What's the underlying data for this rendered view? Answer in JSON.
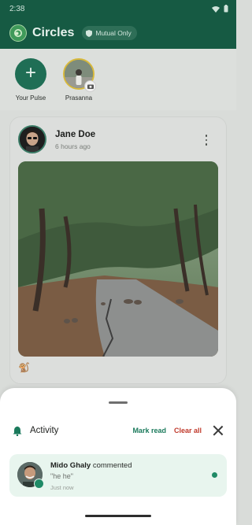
{
  "status": {
    "time": "2:38"
  },
  "header": {
    "app_title": "Circles",
    "audience_badge": "Mutual Only"
  },
  "stories": [
    {
      "label": "Your Pulse",
      "icon": "plus-icon"
    },
    {
      "label": "Prasanna",
      "icon": "avatar"
    }
  ],
  "post": {
    "author": "Jane Doe",
    "time": "6 hours ago",
    "reaction": "🐒"
  },
  "activity": {
    "title": "Activity",
    "mark_read": "Mark read",
    "clear_all": "Clear all",
    "notification": {
      "name": "Mido Ghaly",
      "action": "commented",
      "quote": "\"he he\"",
      "time": "Just now"
    }
  },
  "colors": {
    "brand": "#165a43",
    "accent": "#1f8a66",
    "danger": "#c0392b"
  }
}
